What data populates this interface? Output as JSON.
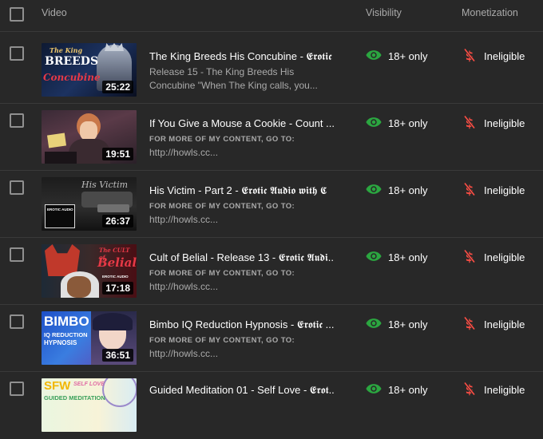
{
  "header": {
    "video": "Video",
    "visibility": "Visibility",
    "monetization": "Monetization"
  },
  "colors": {
    "visibility_icon": "#2ba640",
    "monetization_icon": "#ff4e45",
    "background": "#282828"
  },
  "icons": {
    "visibility": "eye-icon",
    "monetization": "dollar-slash-icon"
  },
  "rows": [
    {
      "title": "The King Breeds His Concubine - 𝕰𝖗𝖔𝖙𝖎𝖈",
      "duration": "25:22",
      "desc1": "Release 15 - The King Breeds His",
      "desc2": "Concubine \"When The King calls, you...",
      "visibility": "18+ only",
      "monetization": "Ineligible",
      "thumb_text": {
        "a": "The King",
        "b": "BREEDS",
        "c": "Concubine"
      }
    },
    {
      "title": "If You Give a Mouse a Cookie - Count ...",
      "duration": "19:51",
      "desc1": "FOR MORE OF MY CONTENT, GO TO:",
      "desc2": "http://howls.cc...",
      "visibility": "18+ only",
      "monetization": "Ineligible"
    },
    {
      "title": "His Victim - Part 2 - 𝕰𝖗𝖔𝖙𝖎𝖈 𝕬𝖚𝖉𝖎𝖔 𝖜𝖎𝖙𝖍 𝕮",
      "duration": "26:37",
      "desc1": "FOR MORE OF MY CONTENT, GO TO:",
      "desc2": "http://howls.cc...",
      "visibility": "18+ only",
      "monetization": "Ineligible",
      "thumb_text": {
        "a": "His Victim",
        "b": "EROTIC AUDIO"
      }
    },
    {
      "title": "Cult of Belial - Release 13 - 𝕰𝖗𝖔𝖙𝖎𝖈 𝕬𝖚𝖉𝖎...",
      "duration": "17:18",
      "desc1": "FOR MORE OF MY CONTENT, GO TO:",
      "desc2": "http://howls.cc...",
      "visibility": "18+ only",
      "monetization": "Ineligible",
      "thumb_text": {
        "a": "The CULT of",
        "b": "Belial",
        "c": "EROTIC AUDIO"
      }
    },
    {
      "title": "Bimbo IQ Reduction Hypnosis - 𝕰𝖗𝖔𝖙𝖎𝖈 ...",
      "duration": "36:51",
      "desc1": "FOR MORE OF MY CONTENT, GO TO:",
      "desc2": "http://howls.cc...",
      "visibility": "18+ only",
      "monetization": "Ineligible",
      "thumb_text": {
        "a": "BIMBO",
        "b": "IQ REDUCTION",
        "c": "HYPNOSIS"
      }
    },
    {
      "title": "Guided Meditation 01 - Self Love - 𝕰𝖗𝖔𝖙...",
      "duration": "",
      "desc1": "",
      "desc2": "",
      "visibility": "18+ only",
      "monetization": "Ineligible",
      "thumb_text": {
        "a": "SFW",
        "b": "SELF LOVE",
        "c": "GUIDED MEDITATION"
      }
    }
  ]
}
